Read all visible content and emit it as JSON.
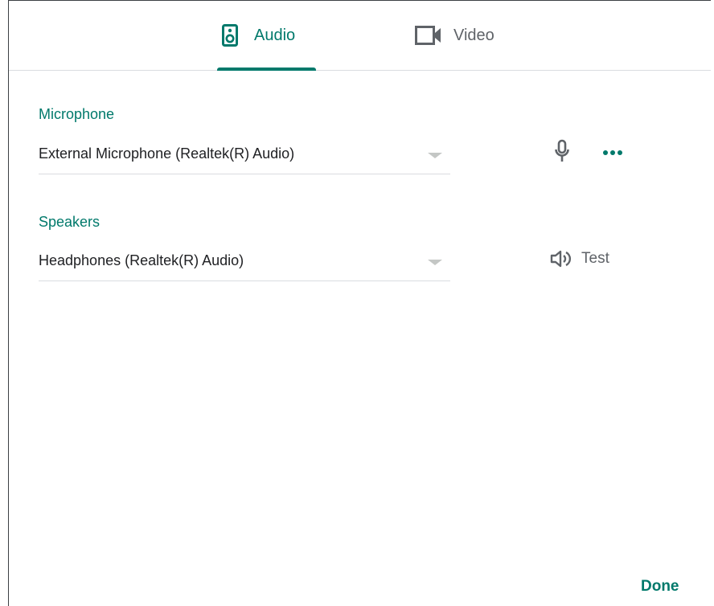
{
  "tabs": {
    "audio": {
      "label": "Audio",
      "selected": true,
      "icon": "speaker-icon"
    },
    "video": {
      "label": "Video",
      "selected": false,
      "icon": "videocam-icon"
    }
  },
  "microphone": {
    "label": "Microphone",
    "selected_value": "External Microphone (Realtek(R) Audio)",
    "action_icons": [
      "microphone-icon",
      "more-horizontal-icon"
    ]
  },
  "speakers": {
    "label": "Speakers",
    "selected_value": "Headphones (Realtek(R) Audio)",
    "test_label": "Test",
    "test_icon": "volume-icon"
  },
  "footer": {
    "done_label": "Done"
  },
  "colors": {
    "accent": "#00796b",
    "secondary_text": "#5f6368",
    "primary_text": "#202124",
    "divider": "#dadce0"
  }
}
